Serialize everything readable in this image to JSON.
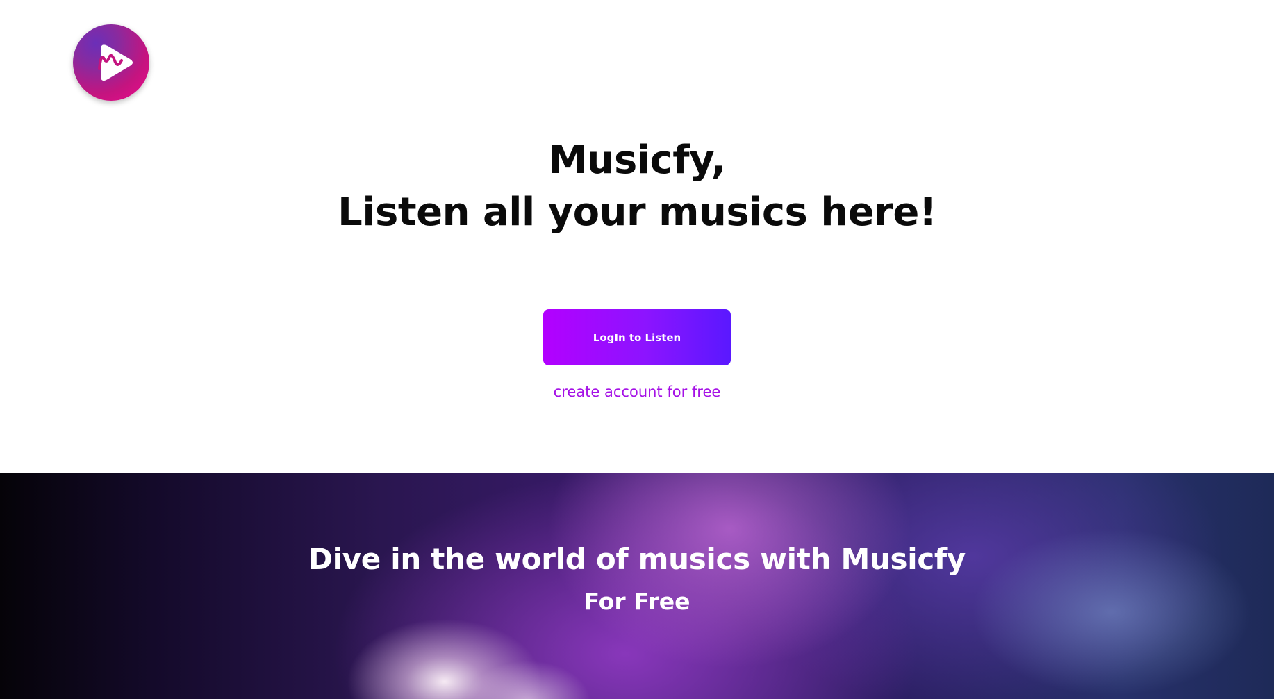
{
  "logo": {
    "icon": "play-m-icon",
    "colors": {
      "outer_top": "#6b2fb8",
      "outer_bottom": "#ee0a8c",
      "glyph": "#ffffff",
      "letter": "#c4147f"
    }
  },
  "hero": {
    "headline_line1": "Musicfy,",
    "headline_line2": "Listen all your musics here!",
    "login_label": "LogIn to Listen",
    "signup_link": "create account for free"
  },
  "banner": {
    "title": "Dive in the world of musics with Musicfy",
    "subtitle": "For Free"
  },
  "colors": {
    "accent": "#a511e6",
    "button_start": "#b300ff",
    "button_end": "#5a18ff",
    "text_dark": "#0a0a0a",
    "banner_text": "#ffffff"
  }
}
